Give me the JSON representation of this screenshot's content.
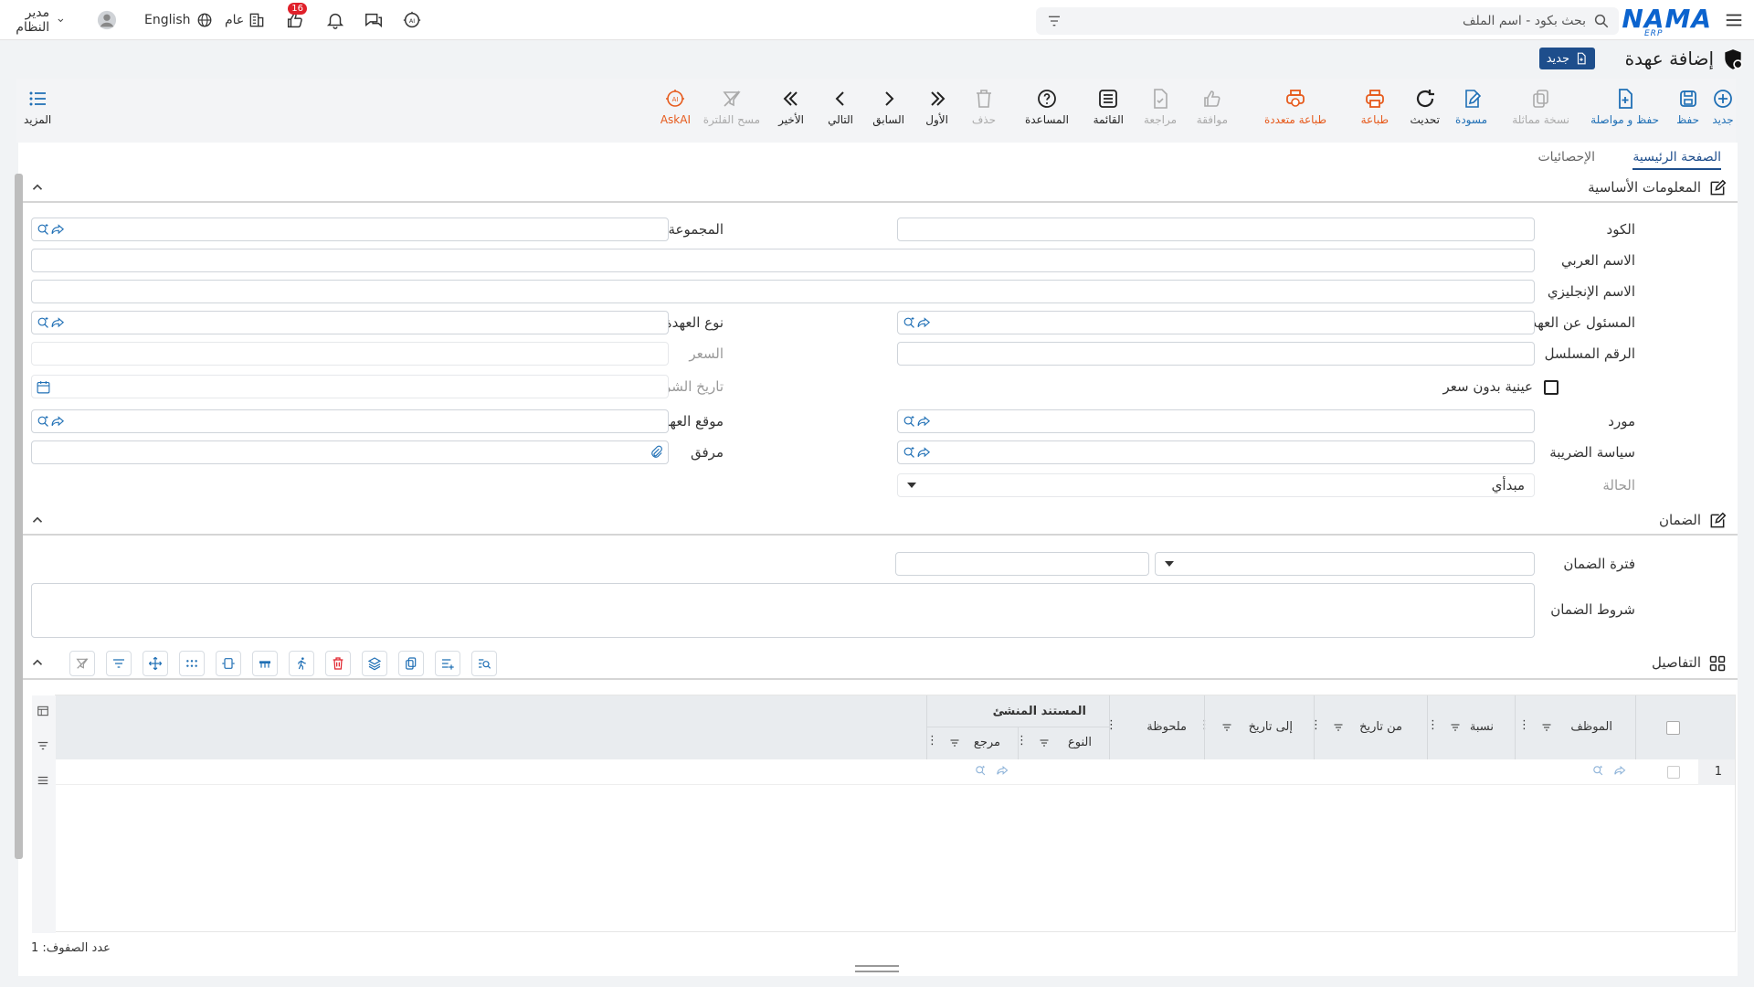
{
  "topbar": {
    "logo": "NAMA",
    "logo_sub": "ERP",
    "search_placeholder": "بحث بكود - اسم الملف",
    "language": "English",
    "scope": "عام",
    "notifications_count": "16",
    "user_name": "مدير النظام"
  },
  "title": {
    "text": "إضافة عهدة",
    "new_chip": "جديد"
  },
  "toolbar": [
    {
      "key": "new",
      "label": "جديد",
      "icon": "plus-circle-icon",
      "state": "blue"
    },
    {
      "key": "save",
      "label": "حفظ",
      "icon": "save-icon",
      "state": "blue"
    },
    {
      "key": "save_continue",
      "label": "حفظ و مواصلة",
      "icon": "file-plus-icon",
      "state": "blue"
    },
    {
      "key": "duplicate",
      "label": "نسخة مماثلة",
      "icon": "copy-icon",
      "state": "disabled"
    },
    {
      "key": "draft",
      "label": "مسودة",
      "icon": "edit-icon",
      "state": "blue"
    },
    {
      "key": "refresh",
      "label": "تحديث",
      "icon": "refresh-icon",
      "state": "dark"
    },
    {
      "key": "print",
      "label": "طباعة",
      "icon": "printer-icon",
      "state": "orange"
    },
    {
      "key": "multi_print",
      "label": "طباعة متعددة",
      "icon": "multi-printer-icon",
      "state": "orange"
    },
    {
      "key": "approve",
      "label": "موافقة",
      "icon": "thumbs-up-icon",
      "state": "disabled"
    },
    {
      "key": "review",
      "label": "مراجعة",
      "icon": "file-check-icon",
      "state": "disabled"
    },
    {
      "key": "list",
      "label": "القائمة",
      "icon": "list-icon",
      "state": "dark"
    },
    {
      "key": "help",
      "label": "المساعدة",
      "icon": "help-icon",
      "state": "dark"
    },
    {
      "key": "delete",
      "label": "حذف",
      "icon": "trash-icon",
      "state": "disabled"
    },
    {
      "key": "first",
      "label": "الأول",
      "icon": "double-chevron-right-icon",
      "state": "dark"
    },
    {
      "key": "prev",
      "label": "السابق",
      "icon": "chevron-right-icon",
      "state": "dark"
    },
    {
      "key": "next",
      "label": "التالي",
      "icon": "chevron-left-icon",
      "state": "dark"
    },
    {
      "key": "last",
      "label": "الأخير",
      "icon": "double-chevron-left-icon",
      "state": "dark"
    },
    {
      "key": "clear_filter",
      "label": "مسح الفلترة",
      "icon": "filter-clear-icon",
      "state": "disabled"
    },
    {
      "key": "askai",
      "label": "AskAI",
      "icon": "ai-icon",
      "state": "orange"
    }
  ],
  "more_label": "المزيد",
  "tabs": [
    "الصفحة الرئيسية",
    "الإحصائيات"
  ],
  "basic_info": {
    "title": "المعلومات الأساسية",
    "code": "الكود",
    "group": "المجموعة",
    "arabic_name": "الاسم العربي",
    "english_name": "الاسم الإنجليزي",
    "responsible": "المسئول عن العهدة",
    "custody_type": "نوع العهدة",
    "serial": "الرقم المسلسل",
    "price": "السعر",
    "sample_no_price": "عينية بدون سعر",
    "purchase_date": "تاريخ الشراء",
    "supplier": "مورد",
    "custody_location": "موقع العهدة",
    "tax_policy": "سياسة الضريبة",
    "attachment": "مرفق",
    "status_label": "الحالة",
    "status_value": "مبدأي"
  },
  "warranty": {
    "title": "الضمان",
    "period": "فترة الضمان",
    "terms": "شروط الضمان"
  },
  "details": {
    "title": "التفاصيل",
    "group_header": "المستند المنشئ",
    "columns": [
      "الموظف",
      "نسبة",
      "من تاريخ",
      "إلى تاريخ",
      "ملحوظة",
      "النوع",
      "مرجع"
    ],
    "rows": [
      {
        "num": "1"
      }
    ],
    "rows_count": "عدد الصفوف: 1"
  }
}
